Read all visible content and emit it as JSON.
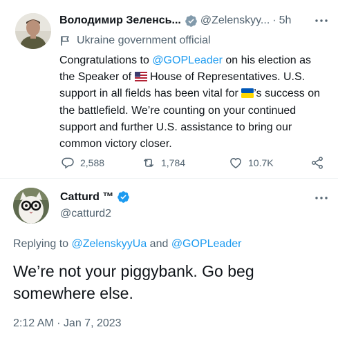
{
  "tweet1": {
    "author_name": "Володимир Зеленсь...",
    "handle": "@Zelenskyy...",
    "separator": "·",
    "time": "5h",
    "label": "Ukraine government official",
    "text": {
      "part1": "Congratulations to ",
      "mention": "@GOPLeader",
      "part2": " on his election as the Speaker of ",
      "part3": " House of Representatives. U.S. support in all fields has been vital for ",
      "part4": "’s success on the battlefield. We’re counting on your continued support and further U.S. assistance to bring our common victory closer."
    },
    "stats": {
      "replies": "2,588",
      "retweets": "1,784",
      "likes": "10.7K"
    }
  },
  "tweet2": {
    "author_name": "Catturd ™",
    "handle": "@catturd2",
    "replying_prefix": "Replying to ",
    "replying_mention1": "@ZelenskyyUa",
    "replying_and": " and ",
    "replying_mention2": "@GOPLeader",
    "text": "We’re not your piggybank. Go beg somewhere else.",
    "timestamp": "2:12 AM · Jan 7, 2023"
  },
  "colors": {
    "accent": "#1d9bf0",
    "secondary_text": "#536471",
    "verified_gold": "#e2b719",
    "verified_blue": "#1d9bf0"
  },
  "icons": [
    "verified-badge-icon",
    "more-icon",
    "government-flag-icon",
    "reply-icon",
    "retweet-icon",
    "like-icon",
    "share-icon",
    "us-flag-emoji",
    "ukraine-flag-emoji"
  ]
}
